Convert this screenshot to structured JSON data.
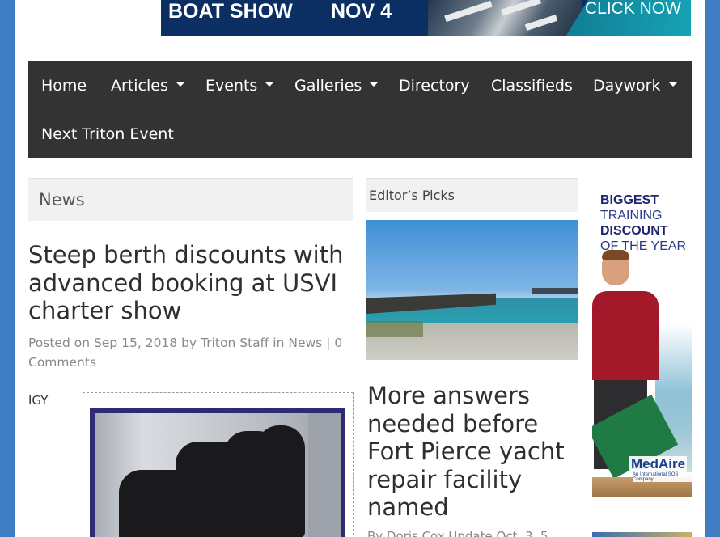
{
  "banner": {
    "left_text": "BOAT SHOW",
    "date_text": "NOV 4",
    "cta_text": "CLICK NOW"
  },
  "nav": {
    "items": [
      {
        "label": "Home",
        "has_dropdown": false
      },
      {
        "label": "Articles",
        "has_dropdown": true
      },
      {
        "label": "Events",
        "has_dropdown": true
      },
      {
        "label": "Galleries",
        "has_dropdown": true
      },
      {
        "label": "Directory",
        "has_dropdown": false
      },
      {
        "label": "Classifieds",
        "has_dropdown": false
      },
      {
        "label": "Daywork",
        "has_dropdown": true
      },
      {
        "label": "Next Triton Event",
        "has_dropdown": false
      }
    ]
  },
  "news": {
    "heading": "News",
    "article": {
      "title": "Steep berth discounts with advanced booking at USVI charter show",
      "posted_prefix": "Posted on",
      "date": "Sep 15, 2018",
      "by": "by",
      "author": "Triton Staff",
      "in": "in",
      "category": "News",
      "separator": "|",
      "comments": "0 Comments",
      "image_caption_left": "IGY"
    }
  },
  "editors_picks": {
    "heading": "Editor’s Picks",
    "article": {
      "title": "More answers needed before Fort Pierce yacht repair facility named",
      "meta_partial": "By Doris Cox Update Oct. 3, 5"
    }
  },
  "ad": {
    "lines": [
      "BIGGEST",
      "TRAINING",
      "DISCOUNT",
      "OF THE YEAR"
    ],
    "brand": "MedAire",
    "brand_sub": "An International SOS Company"
  },
  "colors": {
    "nav_bg": "#333333",
    "page_border": "#3f7ec3",
    "banner_bg": "#0b2f63"
  }
}
